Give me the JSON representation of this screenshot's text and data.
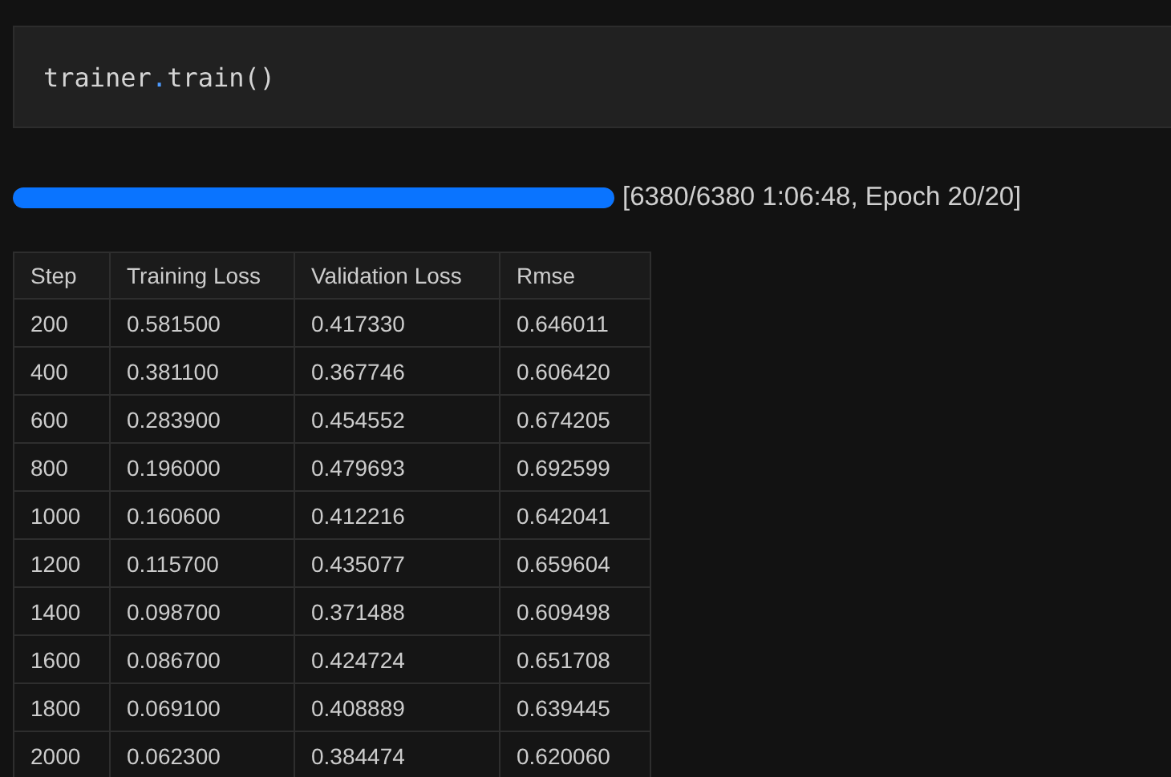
{
  "cell": {
    "code": [
      {
        "text": "trainer",
        "kind": "name"
      },
      {
        "text": ".",
        "kind": "operator"
      },
      {
        "text": "train()",
        "kind": "name"
      }
    ]
  },
  "progress": {
    "level": 1,
    "status": "[6380/6380 1:06:48, Epoch 20/20]"
  },
  "table": {
    "columns": [
      "Step",
      "Training Loss",
      "Validation Loss",
      "Rmse"
    ],
    "rows": [
      [
        "200",
        "0.581500",
        "0.417330",
        "0.646011"
      ],
      [
        "400",
        "0.381100",
        "0.367746",
        "0.606420"
      ],
      [
        "600",
        "0.283900",
        "0.454552",
        "0.674205"
      ],
      [
        "800",
        "0.196000",
        "0.479693",
        "0.692599"
      ],
      [
        "1000",
        "0.160600",
        "0.412216",
        "0.642041"
      ],
      [
        "1200",
        "0.115700",
        "0.435077",
        "0.659604"
      ],
      [
        "1400",
        "0.098700",
        "0.371488",
        "0.609498"
      ],
      [
        "1600",
        "0.086700",
        "0.424724",
        "0.651708"
      ],
      [
        "1800",
        "0.069100",
        "0.408889",
        "0.639445"
      ],
      [
        "2000",
        "0.062300",
        "0.384474",
        "0.620060"
      ]
    ]
  }
}
